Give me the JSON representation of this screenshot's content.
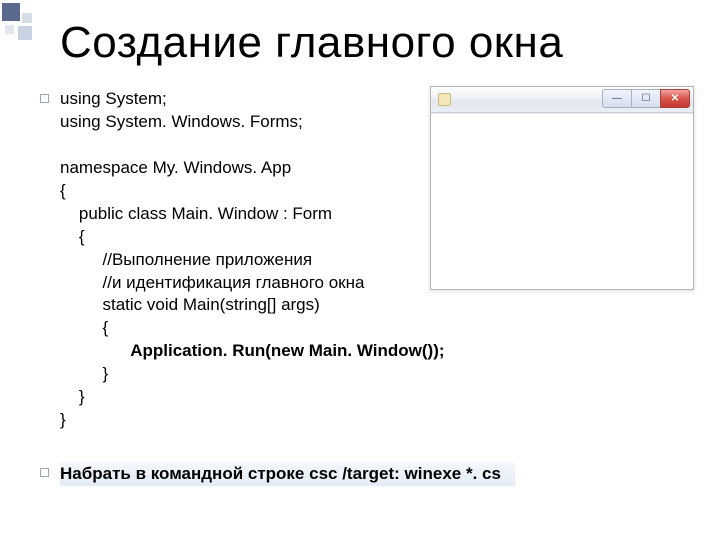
{
  "title": "Создание главного окна",
  "code": {
    "l1": "using System;",
    "l2": "using System. Windows. Forms;",
    "l3": "namespace My. Windows. App",
    "l4": "{",
    "l5": "    public class Main. Window : Form",
    "l6": "    {",
    "l7": "         //Выполнение приложения",
    "l8": "         //и идентификация главного окна",
    "l9": "         static void Main(string[] args)",
    "l10": "         {",
    "l11_bold": "               Application. Run(new Main. Window());",
    "l12": "         }",
    "l13": "    }",
    "l14": "}"
  },
  "footer": "Набрать в командной строке csc /target: winexe *. cs",
  "window": {
    "min_glyph": "—",
    "max_glyph": "☐",
    "close_glyph": "✕"
  }
}
